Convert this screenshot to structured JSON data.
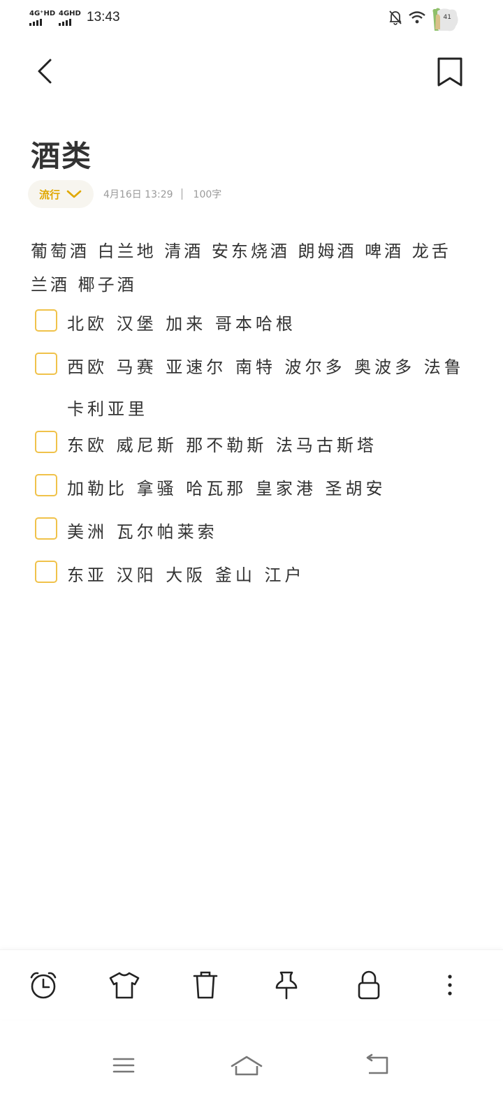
{
  "status_bar": {
    "sim1_label": "4G⁺HD",
    "sim2_label": "4GHD",
    "time": "13:43",
    "icons": [
      "bell-off-icon",
      "wifi-icon"
    ],
    "battery_level": "41"
  },
  "header": {
    "back_icon": "chevron-left-icon",
    "bookmark_icon": "bookmark-icon"
  },
  "note": {
    "title": "酒类",
    "category": "流行",
    "date": "4月16日  13:29",
    "word_count": "100字",
    "body": "葡萄酒 白兰地 清酒 安东烧酒 朗姆酒 啤酒 龙舌兰酒 椰子酒",
    "checklist": [
      {
        "text": "北欧 汉堡 加来 哥本哈根",
        "checked": false
      },
      {
        "text": "西欧 马赛 亚速尔 南特 波尔多 奥波多 法鲁卡利亚里",
        "checked": false
      },
      {
        "text": "东欧 威尼斯 那不勒斯 法马古斯塔",
        "checked": false
      },
      {
        "text": "加勒比 拿骚 哈瓦那 皇家港 圣胡安",
        "checked": false
      },
      {
        "text": "美洲 瓦尔帕莱索",
        "checked": false
      },
      {
        "text": "东亚 汉阳 大阪 釜山 江户",
        "checked": false
      }
    ]
  },
  "toolbar": {
    "items": [
      "alarm-clock-icon",
      "shirt-icon",
      "trash-icon",
      "pin-icon",
      "lock-icon",
      "more-icon"
    ]
  },
  "navbar": {
    "items": [
      "menu-icon",
      "home-icon",
      "back-icon"
    ]
  },
  "colors": {
    "accent": "#f0c24a",
    "category_text": "#e0a800",
    "meta_text": "#9a9a9a",
    "text": "#333333"
  }
}
